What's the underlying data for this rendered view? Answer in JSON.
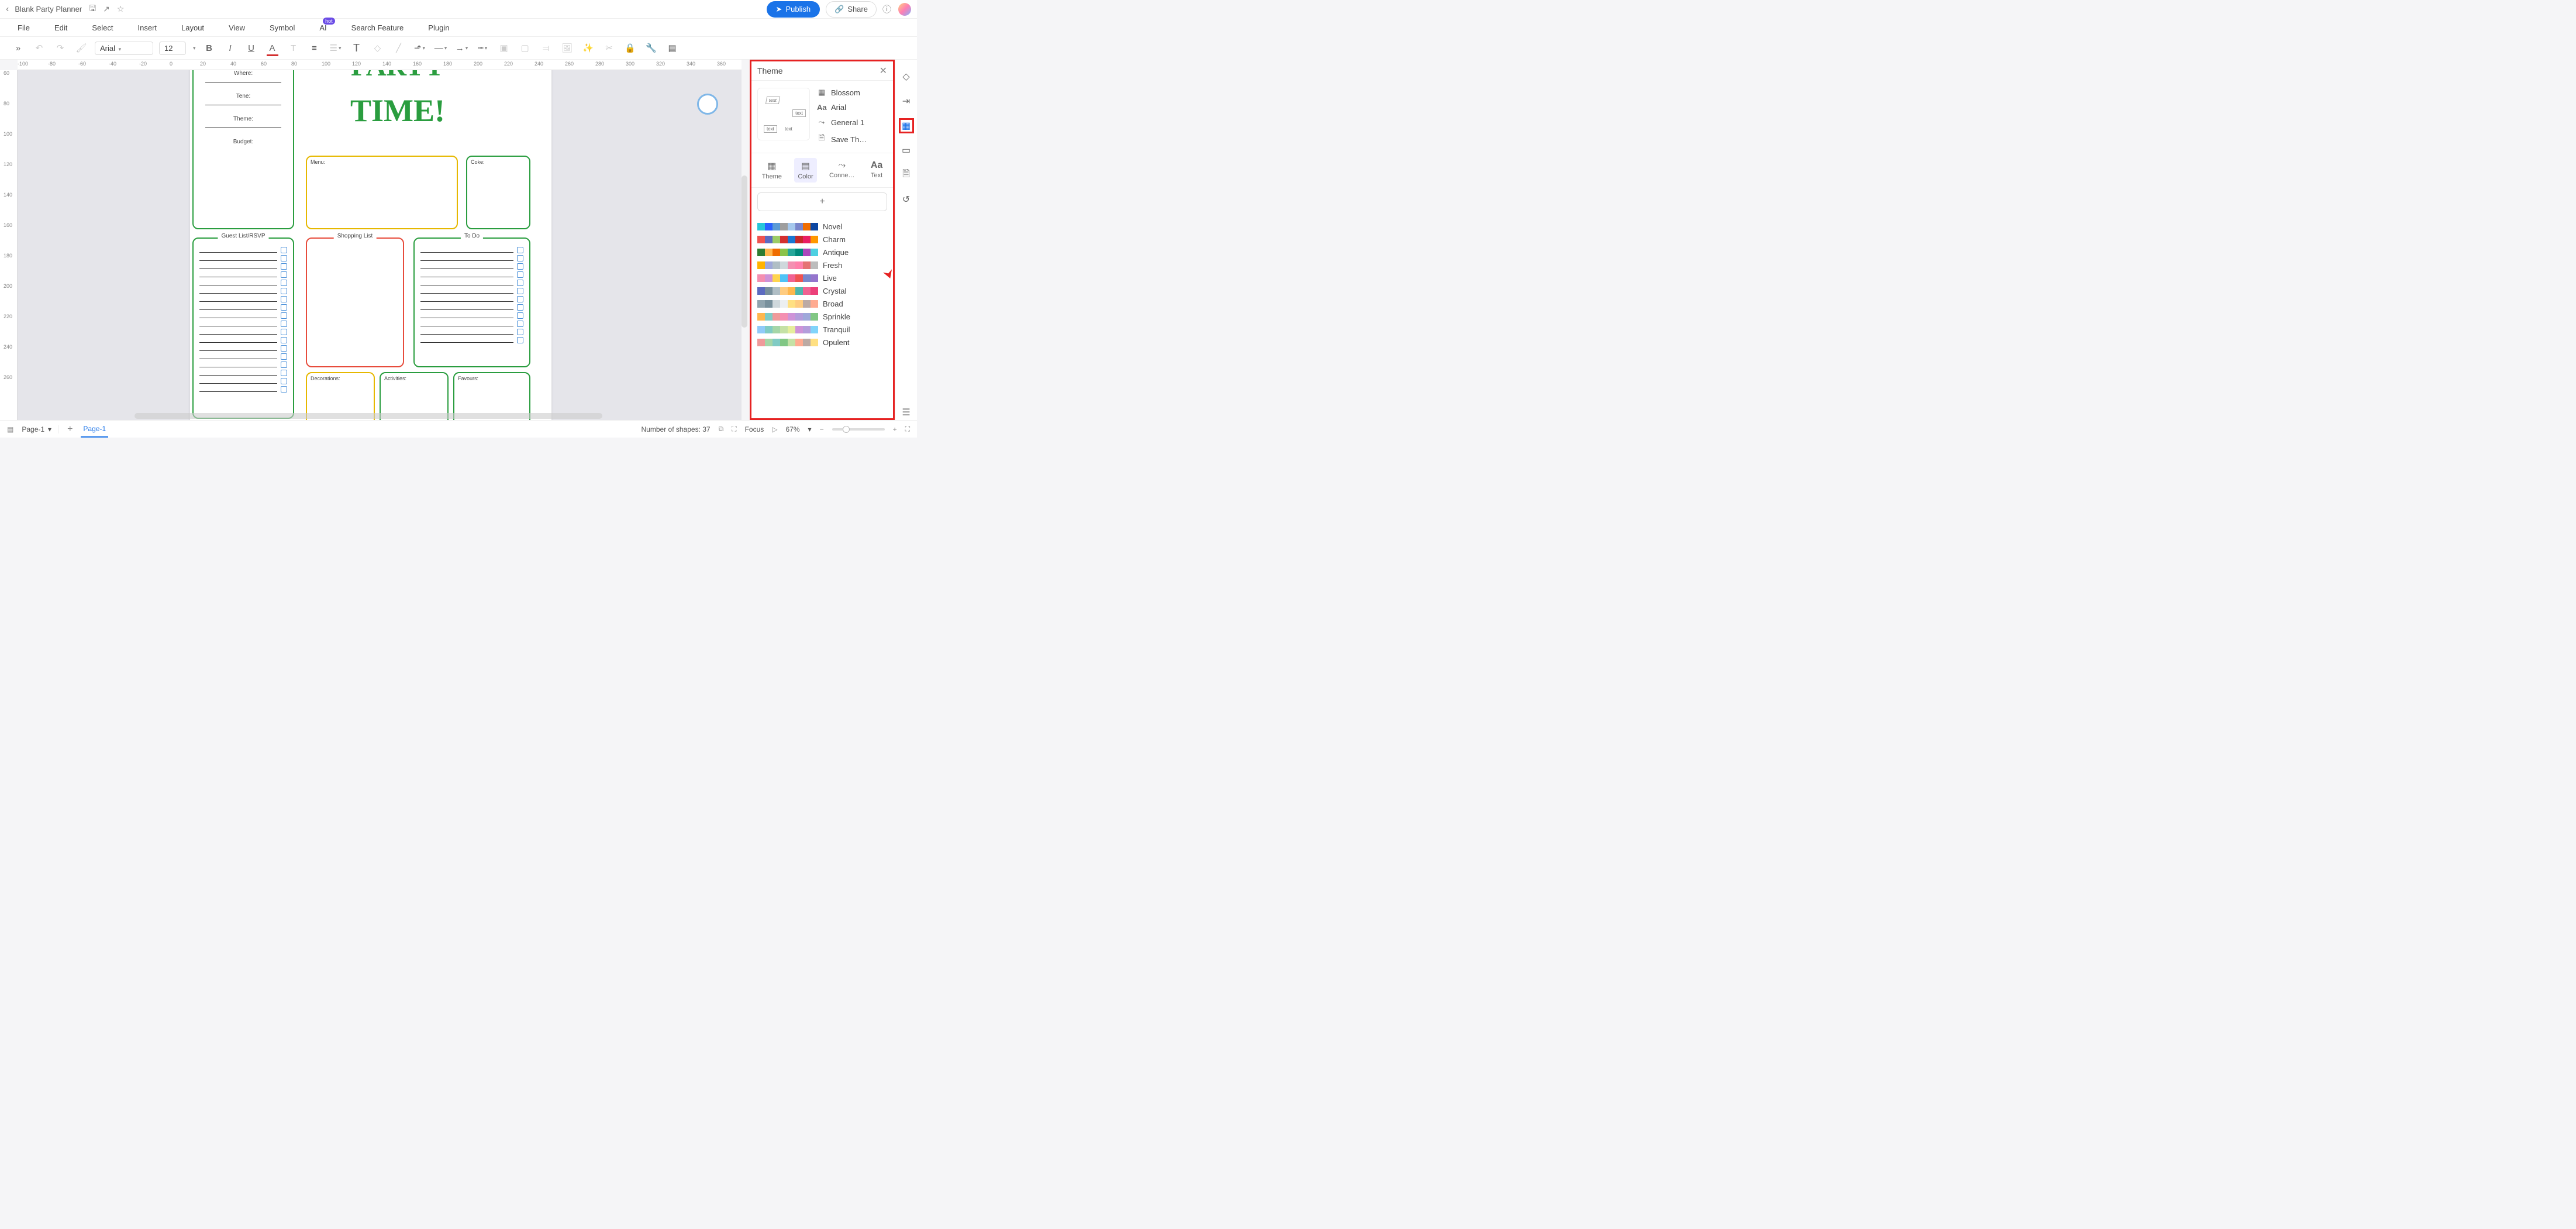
{
  "titlebar": {
    "title": "Blank Party Planner",
    "publish": "Publish",
    "share": "Share"
  },
  "menu": {
    "file": "File",
    "edit": "Edit",
    "select": "Select",
    "insert": "Insert",
    "layout": "Layout",
    "view": "View",
    "symbol": "Symbol",
    "ai": "AI",
    "ai_badge": "hot",
    "search": "Search Feature",
    "plugin": "Plugin"
  },
  "toolbar": {
    "font": "Arial",
    "size": "12"
  },
  "ruler_h": [
    "-100",
    "-80",
    "-60",
    "-40",
    "-20",
    "0",
    "20",
    "40",
    "60",
    "80",
    "100",
    "120",
    "140",
    "160",
    "180",
    "200",
    "220",
    "240",
    "260",
    "280",
    "300",
    "320",
    "340",
    "360"
  ],
  "ruler_v": [
    "60",
    "80",
    "100",
    "120",
    "140",
    "160",
    "180",
    "200",
    "220",
    "240",
    "260"
  ],
  "planner": {
    "title1": "PARTY",
    "title2": "TIME!",
    "where": "Where:",
    "tene": "Tene:",
    "theme": "Theme:",
    "budget": "Budget:",
    "menu": "Menu:",
    "coke": "Coke:",
    "guest": "Guest List/RSVP",
    "shopping": "Shopping List",
    "todo": "To Do",
    "decor": "Decorations:",
    "activities": "Activities:",
    "favours": "Favours:"
  },
  "theme": {
    "header": "Theme",
    "meta": {
      "blossom": "Blossom",
      "font": "Arial",
      "connector": "General 1",
      "save": "Save Th…"
    },
    "tabs": {
      "theme": "Theme",
      "color": "Color",
      "conn": "Conne…",
      "text": "Text"
    },
    "palettes": [
      {
        "name": "Novel",
        "colors": [
          "#26c6da",
          "#2962ff",
          "#5b9bd5",
          "#9e9e9e",
          "#a5c8ed",
          "#7986cb",
          "#ef6c00",
          "#0d47a1"
        ]
      },
      {
        "name": "Charm",
        "colors": [
          "#ef5350",
          "#5c6bc0",
          "#9ccc65",
          "#d32f2f",
          "#1976d2",
          "#c62828",
          "#e91e63",
          "#ff9800"
        ]
      },
      {
        "name": "Antique",
        "colors": [
          "#2e7d32",
          "#ffb74d",
          "#ef6c00",
          "#8bc34a",
          "#26a69a",
          "#00897b",
          "#ab47bc",
          "#4dd0e1"
        ]
      },
      {
        "name": "Fresh",
        "colors": [
          "#ffb300",
          "#9fa8da",
          "#b0bec5",
          "#cfd8dc",
          "#f48fb1",
          "#ff80ab",
          "#e57373",
          "#bdbdbd"
        ]
      },
      {
        "name": "Live",
        "colors": [
          "#f48fb1",
          "#ce93d8",
          "#ffd54f",
          "#4fc3f7",
          "#f06292",
          "#ef5350",
          "#7986cb",
          "#9575cd"
        ]
      },
      {
        "name": "Crystal",
        "colors": [
          "#5c6bc0",
          "#78909c",
          "#b0bec5",
          "#ffcc80",
          "#ffb74d",
          "#4db6ac",
          "#f06292",
          "#ec407a"
        ]
      },
      {
        "name": "Broad",
        "colors": [
          "#90a4ae",
          "#78909c",
          "#cfd8dc",
          "#eceff1",
          "#ffe082",
          "#ffcc80",
          "#bcaaa4",
          "#ffab91"
        ]
      },
      {
        "name": "Sprinkle",
        "colors": [
          "#ffb74d",
          "#80cbc4",
          "#ef9a9a",
          "#f48fb1",
          "#ce93d8",
          "#b39ddb",
          "#9fa8da",
          "#81c784"
        ]
      },
      {
        "name": "Tranquil",
        "colors": [
          "#90caf9",
          "#80cbc4",
          "#a5d6a7",
          "#c5e1a5",
          "#e6ee9c",
          "#ce93d8",
          "#b39ddb",
          "#81d4fa"
        ]
      },
      {
        "name": "Opulent",
        "colors": [
          "#ef9a9a",
          "#a5d6a7",
          "#80cbc4",
          "#81c784",
          "#c5e1a5",
          "#ffab91",
          "#bcaaa4",
          "#ffe082"
        ]
      }
    ]
  },
  "status": {
    "page": "Page-1",
    "tab": "Page-1",
    "shapes": "Number of shapes: 37",
    "focus": "Focus",
    "zoom": "67%"
  }
}
